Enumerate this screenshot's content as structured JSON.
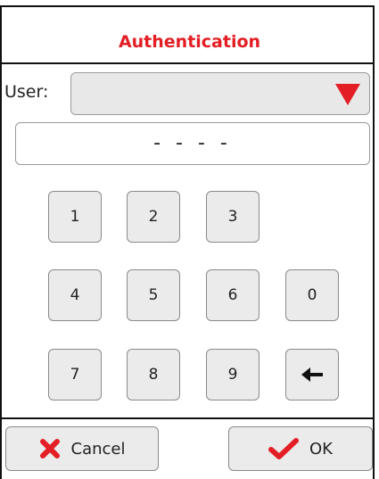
{
  "dialog": {
    "title": "Authentication",
    "user_label": "User:",
    "user_value": "",
    "pin_display": "- - - -"
  },
  "keypad": {
    "keys": [
      "1",
      "2",
      "3",
      "4",
      "5",
      "6",
      "0",
      "7",
      "8",
      "9"
    ],
    "backspace_icon": "left-arrow-icon"
  },
  "buttons": {
    "cancel_label": "Cancel",
    "cancel_icon": "red-x-icon",
    "ok_label": "OK",
    "ok_icon": "red-check-icon"
  },
  "colors": {
    "accent": "#e31e24",
    "button_bg": "#ebebeb",
    "select_bg": "#e8e8e8"
  }
}
